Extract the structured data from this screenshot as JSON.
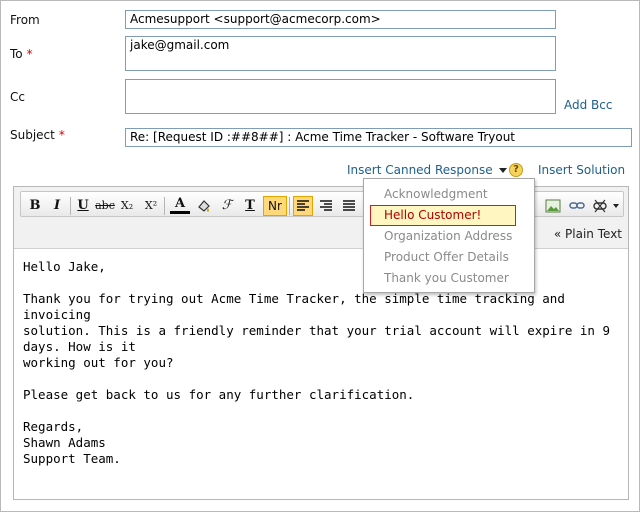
{
  "form": {
    "from_label": "From",
    "from_value": "Acmesupport <support@acmecorp.com>",
    "to_label": "To",
    "to_value": "jake@gmail.com",
    "cc_label": "Cc",
    "cc_value": "",
    "add_bcc": "Add Bcc",
    "subject_label": "Subject",
    "subject_value": "Re: [Request ID :##8##] : Acme Time Tracker - Software Tryout",
    "required_mark": "*"
  },
  "actions": {
    "insert_canned": "Insert Canned Response",
    "help": "?",
    "insert_solution": "Insert Solution"
  },
  "toolbar": {
    "bold": "B",
    "italic": "I",
    "underline": "U",
    "strike": "abc",
    "subscript": "X₂",
    "superscript": "X²",
    "font_color": "A",
    "font_family": "ℱ",
    "text_size": "T",
    "normal": "Nr",
    "plain_text": "« Plain Text"
  },
  "canned_menu": {
    "items": [
      "Acknowledgment",
      "Hello Customer!",
      "Organization Address",
      "Product Offer Details",
      "Thank you Customer"
    ],
    "selected_index": 1
  },
  "message": {
    "greeting": "Hello Jake,",
    "para1_l1": "Thank you for trying out Acme Time Tracker, the simple time tracking and invoicing",
    "para1_l2": "solution. This is a friendly reminder that your trial account will expire in 9 days. How is it",
    "para1_l3": "working out for you?",
    "para2": "Please get back to us for any further clarification.",
    "regards": "Regards,",
    "name": "Shawn Adams",
    "team": "Support Team."
  },
  "colors": {
    "link": "#1d5f8a",
    "required": "#d40000",
    "field_border": "#7f9db9",
    "selected_item_border": "#d21d1d"
  }
}
